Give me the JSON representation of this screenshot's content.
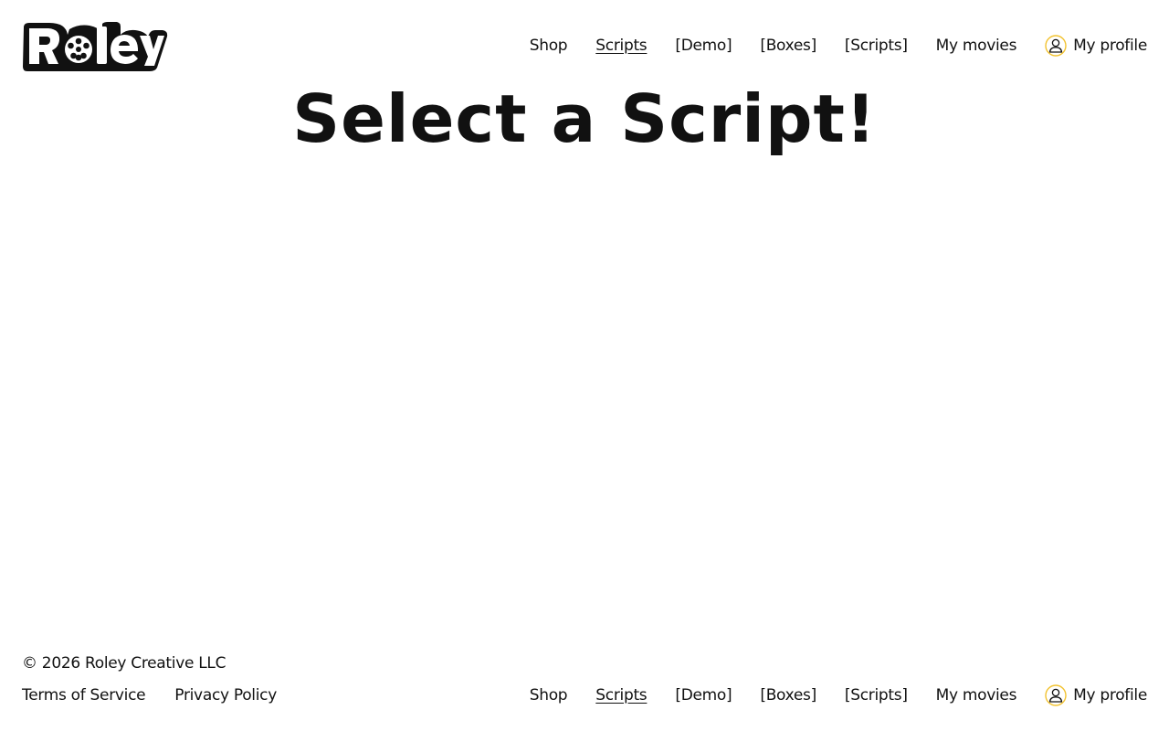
{
  "brand": {
    "logo_text": "Roley",
    "colors": {
      "text": "#111111",
      "background": "#ffffff",
      "profile_icon_accent": "#f2c230"
    }
  },
  "header": {
    "nav": [
      {
        "label": "Shop"
      },
      {
        "label": "Scripts",
        "active": true
      },
      {
        "label": "[Demo]"
      },
      {
        "label": "[Boxes]"
      },
      {
        "label": "[Scripts]"
      },
      {
        "label": "My movies"
      }
    ],
    "profile": {
      "label": "My profile",
      "icon": "user-icon"
    }
  },
  "main": {
    "title": "Select a Script!"
  },
  "footer": {
    "copyright": "© 2026 Roley Creative LLC",
    "legal_links": [
      {
        "label": "Terms of Service"
      },
      {
        "label": "Privacy Policy"
      }
    ],
    "nav": [
      {
        "label": "Shop"
      },
      {
        "label": "Scripts",
        "active": true
      },
      {
        "label": "[Demo]"
      },
      {
        "label": "[Boxes]"
      },
      {
        "label": "[Scripts]"
      },
      {
        "label": "My movies"
      }
    ],
    "profile": {
      "label": "My profile",
      "icon": "user-icon"
    }
  }
}
